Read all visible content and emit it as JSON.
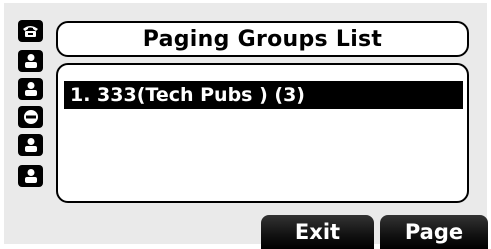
{
  "title": "Paging Groups List",
  "line_keys": [
    {
      "icon": "phone-handset-icon"
    },
    {
      "icon": "person-icon"
    },
    {
      "icon": "person-icon"
    },
    {
      "icon": "do-not-disturb-icon"
    },
    {
      "icon": "person-icon"
    },
    {
      "icon": "person-icon"
    }
  ],
  "list": {
    "items": [
      {
        "label": "1. 333(Tech Pubs ) (3)",
        "selected": true
      }
    ]
  },
  "softkeys": {
    "exit": "Exit",
    "page": "Page"
  }
}
